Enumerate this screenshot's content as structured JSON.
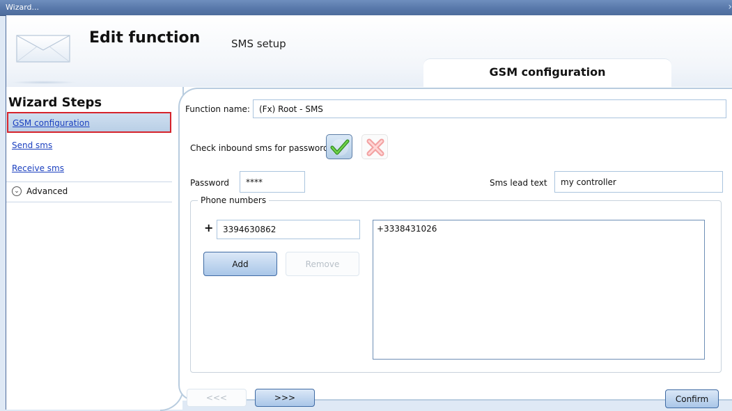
{
  "window": {
    "title": "Wizard...",
    "close_glyph": "›"
  },
  "header": {
    "title": "Edit function",
    "subtitle": "SMS setup",
    "active_tab": "GSM configuration",
    "icon": "envelope-icon"
  },
  "sidebar": {
    "title": "Wizard Steps",
    "items": [
      {
        "label": "GSM configuration",
        "active": true
      },
      {
        "label": "Send sms",
        "active": false
      },
      {
        "label": "Receive sms",
        "active": false
      }
    ],
    "advanced": {
      "label": "Advanced",
      "icon": "chevron-down-circle-icon"
    }
  },
  "form": {
    "function_name_label": "Function name:",
    "function_name_value": "(Fx) Root - SMS",
    "check_inbound_label": "Check inbound sms for password",
    "check_inbound_selected": "yes",
    "password_label": "Password",
    "password_value": "****",
    "sms_lead_label": "Sms lead text",
    "sms_lead_value": "my controller"
  },
  "phone_numbers": {
    "legend": "Phone numbers",
    "prefix": "+",
    "input_value": "3394630862",
    "add_label": "Add",
    "remove_label": "Remove",
    "list": [
      "+3338431026"
    ]
  },
  "nav": {
    "prev_label": "<<<",
    "next_label": ">>>",
    "confirm_label": "Confirm"
  },
  "colors": {
    "titlebar": "#5676a8",
    "link": "#1a3fbf",
    "active_highlight_border": "#d6232b",
    "panel_border": "#b8ccdf"
  }
}
